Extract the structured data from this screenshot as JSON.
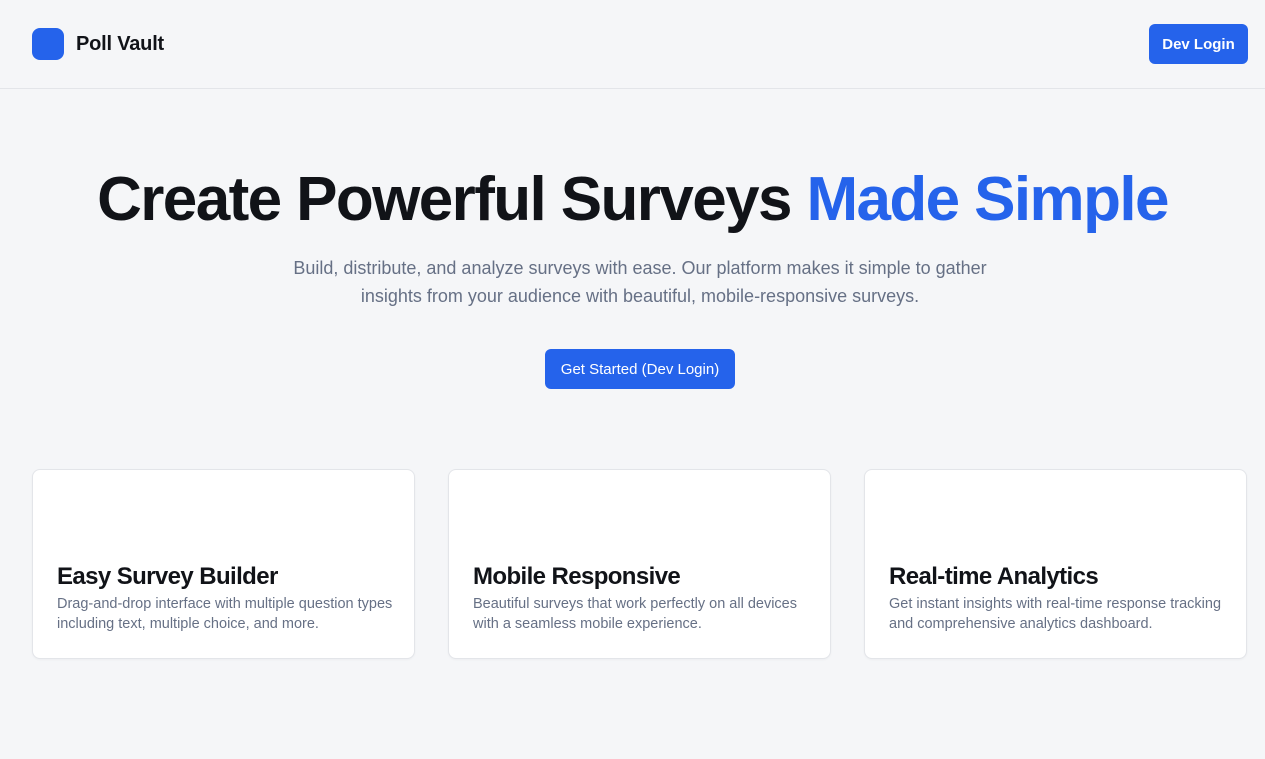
{
  "brand": {
    "name": "Poll Vault",
    "accent_color": "#2563eb"
  },
  "header": {
    "login_label": "Dev Login"
  },
  "hero": {
    "title_main": "Create Powerful Surveys ",
    "title_accent": "Made Simple",
    "subtitle": "Build, distribute, and analyze surveys with ease. Our platform makes it simple to gather insights from your audience with beautiful, mobile-responsive surveys.",
    "cta_label": "Get Started (Dev Login)"
  },
  "features": [
    {
      "title": "Easy Survey Builder",
      "description": "Drag-and-drop interface with multiple question types including text, multiple choice, and more."
    },
    {
      "title": "Mobile Responsive",
      "description": "Beautiful surveys that work perfectly on all devices with a seamless mobile experience."
    },
    {
      "title": "Real-time Analytics",
      "description": "Get instant insights with real-time response tracking and comprehensive analytics dashboard."
    }
  ]
}
